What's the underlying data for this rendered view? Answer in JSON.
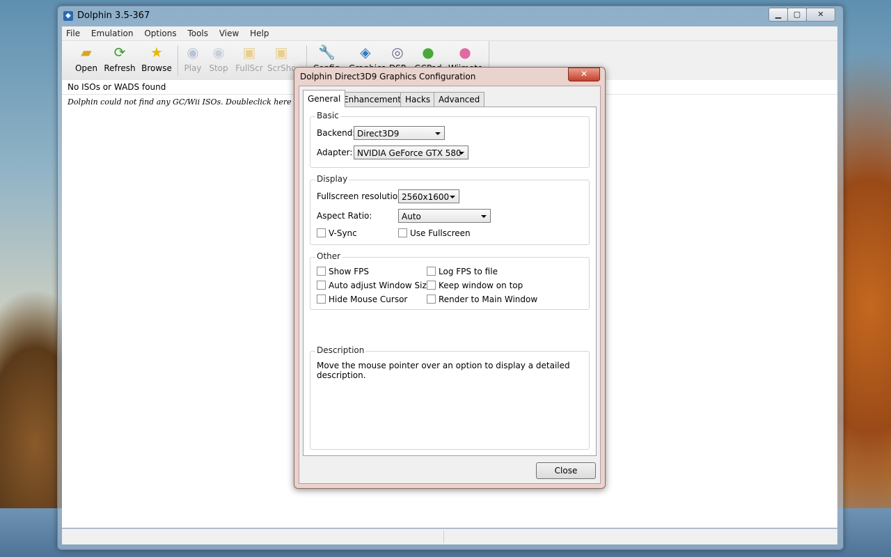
{
  "main_window": {
    "title": "Dolphin 3.5-367",
    "menu": [
      "File",
      "Emulation",
      "Options",
      "Tools",
      "View",
      "Help"
    ],
    "toolbar": [
      {
        "label": "Open",
        "icon": "folder-icon",
        "enabled": true
      },
      {
        "label": "Refresh",
        "icon": "refresh-icon",
        "enabled": true
      },
      {
        "label": "Browse",
        "icon": "star-icon",
        "enabled": true
      },
      {
        "label": "Play",
        "icon": "play-icon",
        "enabled": false
      },
      {
        "label": "Stop",
        "icon": "stop-icon",
        "enabled": false
      },
      {
        "label": "FullScr",
        "icon": "fullscreen-icon",
        "enabled": false
      },
      {
        "label": "ScrShot",
        "icon": "screenshot-icon",
        "enabled": false
      },
      {
        "label": "Config",
        "icon": "wrench-icon",
        "enabled": true
      },
      {
        "label": "Graphics",
        "icon": "graphics-icon",
        "enabled": true
      },
      {
        "label": "DSP",
        "icon": "speaker-icon",
        "enabled": true
      },
      {
        "label": "GCPad",
        "icon": "gcpad-icon",
        "enabled": true
      },
      {
        "label": "Wiimote",
        "icon": "wiimote-icon",
        "enabled": true
      }
    ],
    "list_header": "No ISOs or WADS found",
    "not_found_text": "Dolphin could not find any GC/Wii ISOs.  Doubleclick here to browse for files..."
  },
  "dialog": {
    "title": "Dolphin Direct3D9 Graphics Configuration",
    "tabs": [
      "General",
      "Enhancements",
      "Hacks",
      "Advanced"
    ],
    "active_tab": "General",
    "basic": {
      "label": "Basic",
      "backend_label": "Backend:",
      "backend_value": "Direct3D9",
      "adapter_label": "Adapter:",
      "adapter_value": "NVIDIA GeForce GTX 580"
    },
    "display": {
      "label": "Display",
      "fullscreen_label": "Fullscreen resolution:",
      "fullscreen_value": "2560x1600",
      "aspect_label": "Aspect Ratio:",
      "aspect_value": "Auto",
      "vsync": "V-Sync",
      "use_fullscreen": "Use Fullscreen"
    },
    "other": {
      "label": "Other",
      "show_fps": "Show FPS",
      "log_fps": "Log FPS to file",
      "auto_adjust": "Auto adjust Window Size",
      "keep_on_top": "Keep window on top",
      "hide_cursor": "Hide Mouse Cursor",
      "render_main": "Render to Main Window"
    },
    "description": {
      "label": "Description",
      "text": "Move the mouse pointer over an option to display a detailed description."
    },
    "close_label": "Close"
  }
}
